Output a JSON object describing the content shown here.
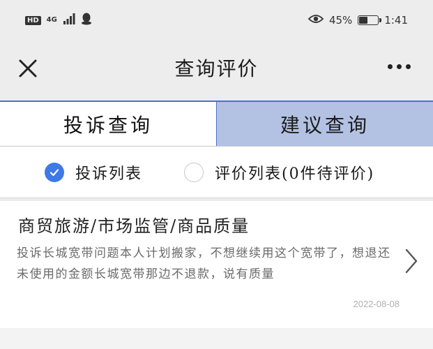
{
  "status_bar": {
    "hd": "HD",
    "network": "4G",
    "battery_percent": "45%",
    "battery_level": 0.45,
    "time": "1:41",
    "icons": [
      "signal-icon",
      "qq-icon",
      "eye-icon",
      "battery-charging-icon"
    ]
  },
  "nav": {
    "title": "查询评价",
    "close_icon": "close-icon",
    "more_icon": "more-icon"
  },
  "tabs": [
    {
      "label": "投诉查询",
      "active": true
    },
    {
      "label": "建议查询",
      "active": false
    }
  ],
  "filters": [
    {
      "label": "投诉列表",
      "selected": true
    },
    {
      "label": "评价列表(0件待评价)",
      "selected": false
    }
  ],
  "items": [
    {
      "title": "商贸旅游/市场监管/商品质量",
      "summary": "投诉长城宽带问题本人计划搬家，不想继续用这个宽带了，想退还未使用的金额长城宽带那边不退款，说有质量",
      "date": "2022-08-08"
    }
  ],
  "colors": {
    "accent": "#3d79e8",
    "tab_border": "#4d6fd0",
    "tab_inactive_bg": "#b3c2e3",
    "bar_bg": "#ededed"
  }
}
